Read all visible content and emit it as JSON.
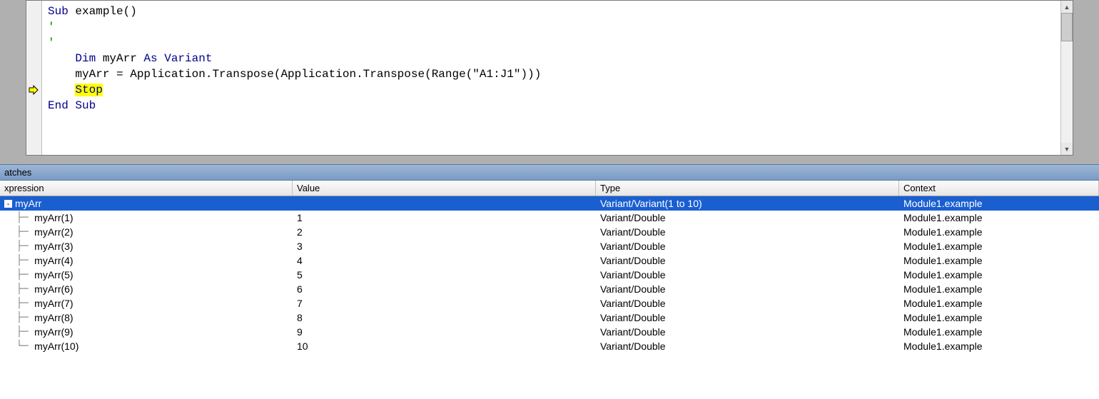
{
  "code": {
    "lines": [
      {
        "indent": 0,
        "segments": [
          {
            "t": "Sub ",
            "c": "kw"
          },
          {
            "t": "example()",
            "c": ""
          }
        ]
      },
      {
        "indent": 0,
        "segments": [
          {
            "t": "'",
            "c": "cm"
          }
        ]
      },
      {
        "indent": 0,
        "segments": [
          {
            "t": "'",
            "c": "cm"
          }
        ]
      },
      {
        "indent": 1,
        "segments": [
          {
            "t": "Dim ",
            "c": "kw"
          },
          {
            "t": "myArr ",
            "c": ""
          },
          {
            "t": "As Variant",
            "c": "kw"
          }
        ]
      },
      {
        "indent": 1,
        "segments": [
          {
            "t": "myArr = Application.Transpose(Application.Transpose(Range(",
            "c": ""
          },
          {
            "t": "\"A1:J1\"",
            "c": ""
          },
          {
            "t": ")))",
            "c": ""
          }
        ]
      },
      {
        "indent": 1,
        "break": true,
        "segments": [
          {
            "t": "Stop",
            "c": "kw hl"
          }
        ]
      },
      {
        "indent": 0,
        "segments": [
          {
            "t": "",
            "c": ""
          }
        ]
      },
      {
        "indent": 0,
        "segments": [
          {
            "t": "End Sub",
            "c": "kw"
          }
        ]
      }
    ]
  },
  "watches": {
    "title": "atches",
    "columns": {
      "expression": "xpression",
      "value": "Value",
      "type": "Type",
      "context": "Context"
    },
    "root": {
      "expression": "myArr",
      "value": "",
      "type": "Variant/Variant(1 to 10)",
      "context": "Module1.example",
      "expanded": true,
      "selected": true
    },
    "children": [
      {
        "expression": "myArr(1)",
        "value": "1",
        "type": "Variant/Double",
        "context": "Module1.example"
      },
      {
        "expression": "myArr(2)",
        "value": "2",
        "type": "Variant/Double",
        "context": "Module1.example"
      },
      {
        "expression": "myArr(3)",
        "value": "3",
        "type": "Variant/Double",
        "context": "Module1.example"
      },
      {
        "expression": "myArr(4)",
        "value": "4",
        "type": "Variant/Double",
        "context": "Module1.example"
      },
      {
        "expression": "myArr(5)",
        "value": "5",
        "type": "Variant/Double",
        "context": "Module1.example"
      },
      {
        "expression": "myArr(6)",
        "value": "6",
        "type": "Variant/Double",
        "context": "Module1.example"
      },
      {
        "expression": "myArr(7)",
        "value": "7",
        "type": "Variant/Double",
        "context": "Module1.example"
      },
      {
        "expression": "myArr(8)",
        "value": "8",
        "type": "Variant/Double",
        "context": "Module1.example"
      },
      {
        "expression": "myArr(9)",
        "value": "9",
        "type": "Variant/Double",
        "context": "Module1.example"
      },
      {
        "expression": "myArr(10)",
        "value": "10",
        "type": "Variant/Double",
        "context": "Module1.example"
      }
    ]
  }
}
